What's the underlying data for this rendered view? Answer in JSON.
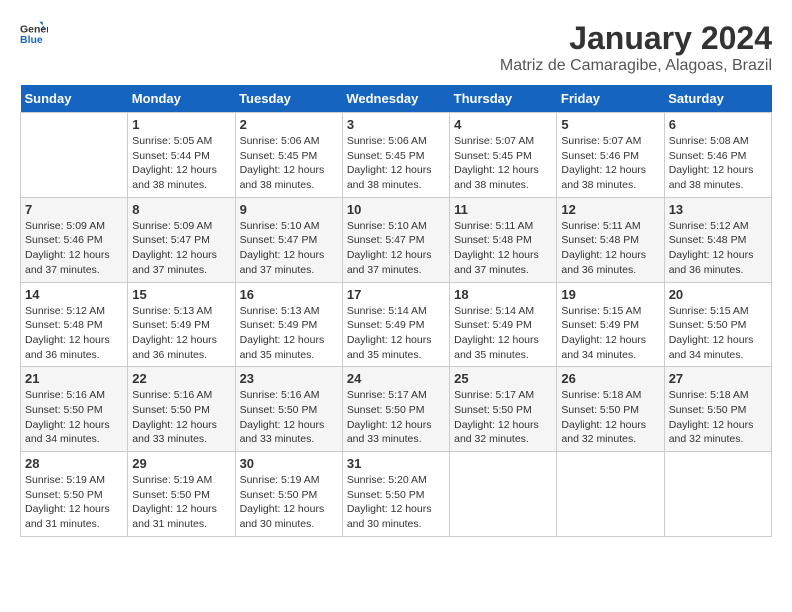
{
  "logo": {
    "line1": "General",
    "line2": "Blue"
  },
  "title": "January 2024",
  "subtitle": "Matriz de Camaragibe, Alagoas, Brazil",
  "days_of_week": [
    "Sunday",
    "Monday",
    "Tuesday",
    "Wednesday",
    "Thursday",
    "Friday",
    "Saturday"
  ],
  "weeks": [
    [
      {
        "day": "",
        "info": ""
      },
      {
        "day": "1",
        "info": "Sunrise: 5:05 AM\nSunset: 5:44 PM\nDaylight: 12 hours\nand 38 minutes."
      },
      {
        "day": "2",
        "info": "Sunrise: 5:06 AM\nSunset: 5:45 PM\nDaylight: 12 hours\nand 38 minutes."
      },
      {
        "day": "3",
        "info": "Sunrise: 5:06 AM\nSunset: 5:45 PM\nDaylight: 12 hours\nand 38 minutes."
      },
      {
        "day": "4",
        "info": "Sunrise: 5:07 AM\nSunset: 5:45 PM\nDaylight: 12 hours\nand 38 minutes."
      },
      {
        "day": "5",
        "info": "Sunrise: 5:07 AM\nSunset: 5:46 PM\nDaylight: 12 hours\nand 38 minutes."
      },
      {
        "day": "6",
        "info": "Sunrise: 5:08 AM\nSunset: 5:46 PM\nDaylight: 12 hours\nand 38 minutes."
      }
    ],
    [
      {
        "day": "7",
        "info": "Sunrise: 5:09 AM\nSunset: 5:46 PM\nDaylight: 12 hours\nand 37 minutes."
      },
      {
        "day": "8",
        "info": "Sunrise: 5:09 AM\nSunset: 5:47 PM\nDaylight: 12 hours\nand 37 minutes."
      },
      {
        "day": "9",
        "info": "Sunrise: 5:10 AM\nSunset: 5:47 PM\nDaylight: 12 hours\nand 37 minutes."
      },
      {
        "day": "10",
        "info": "Sunrise: 5:10 AM\nSunset: 5:47 PM\nDaylight: 12 hours\nand 37 minutes."
      },
      {
        "day": "11",
        "info": "Sunrise: 5:11 AM\nSunset: 5:48 PM\nDaylight: 12 hours\nand 37 minutes."
      },
      {
        "day": "12",
        "info": "Sunrise: 5:11 AM\nSunset: 5:48 PM\nDaylight: 12 hours\nand 36 minutes."
      },
      {
        "day": "13",
        "info": "Sunrise: 5:12 AM\nSunset: 5:48 PM\nDaylight: 12 hours\nand 36 minutes."
      }
    ],
    [
      {
        "day": "14",
        "info": "Sunrise: 5:12 AM\nSunset: 5:48 PM\nDaylight: 12 hours\nand 36 minutes."
      },
      {
        "day": "15",
        "info": "Sunrise: 5:13 AM\nSunset: 5:49 PM\nDaylight: 12 hours\nand 36 minutes."
      },
      {
        "day": "16",
        "info": "Sunrise: 5:13 AM\nSunset: 5:49 PM\nDaylight: 12 hours\nand 35 minutes."
      },
      {
        "day": "17",
        "info": "Sunrise: 5:14 AM\nSunset: 5:49 PM\nDaylight: 12 hours\nand 35 minutes."
      },
      {
        "day": "18",
        "info": "Sunrise: 5:14 AM\nSunset: 5:49 PM\nDaylight: 12 hours\nand 35 minutes."
      },
      {
        "day": "19",
        "info": "Sunrise: 5:15 AM\nSunset: 5:49 PM\nDaylight: 12 hours\nand 34 minutes."
      },
      {
        "day": "20",
        "info": "Sunrise: 5:15 AM\nSunset: 5:50 PM\nDaylight: 12 hours\nand 34 minutes."
      }
    ],
    [
      {
        "day": "21",
        "info": "Sunrise: 5:16 AM\nSunset: 5:50 PM\nDaylight: 12 hours\nand 34 minutes."
      },
      {
        "day": "22",
        "info": "Sunrise: 5:16 AM\nSunset: 5:50 PM\nDaylight: 12 hours\nand 33 minutes."
      },
      {
        "day": "23",
        "info": "Sunrise: 5:16 AM\nSunset: 5:50 PM\nDaylight: 12 hours\nand 33 minutes."
      },
      {
        "day": "24",
        "info": "Sunrise: 5:17 AM\nSunset: 5:50 PM\nDaylight: 12 hours\nand 33 minutes."
      },
      {
        "day": "25",
        "info": "Sunrise: 5:17 AM\nSunset: 5:50 PM\nDaylight: 12 hours\nand 32 minutes."
      },
      {
        "day": "26",
        "info": "Sunrise: 5:18 AM\nSunset: 5:50 PM\nDaylight: 12 hours\nand 32 minutes."
      },
      {
        "day": "27",
        "info": "Sunrise: 5:18 AM\nSunset: 5:50 PM\nDaylight: 12 hours\nand 32 minutes."
      }
    ],
    [
      {
        "day": "28",
        "info": "Sunrise: 5:19 AM\nSunset: 5:50 PM\nDaylight: 12 hours\nand 31 minutes."
      },
      {
        "day": "29",
        "info": "Sunrise: 5:19 AM\nSunset: 5:50 PM\nDaylight: 12 hours\nand 31 minutes."
      },
      {
        "day": "30",
        "info": "Sunrise: 5:19 AM\nSunset: 5:50 PM\nDaylight: 12 hours\nand 30 minutes."
      },
      {
        "day": "31",
        "info": "Sunrise: 5:20 AM\nSunset: 5:50 PM\nDaylight: 12 hours\nand 30 minutes."
      },
      {
        "day": "",
        "info": ""
      },
      {
        "day": "",
        "info": ""
      },
      {
        "day": "",
        "info": ""
      }
    ]
  ]
}
